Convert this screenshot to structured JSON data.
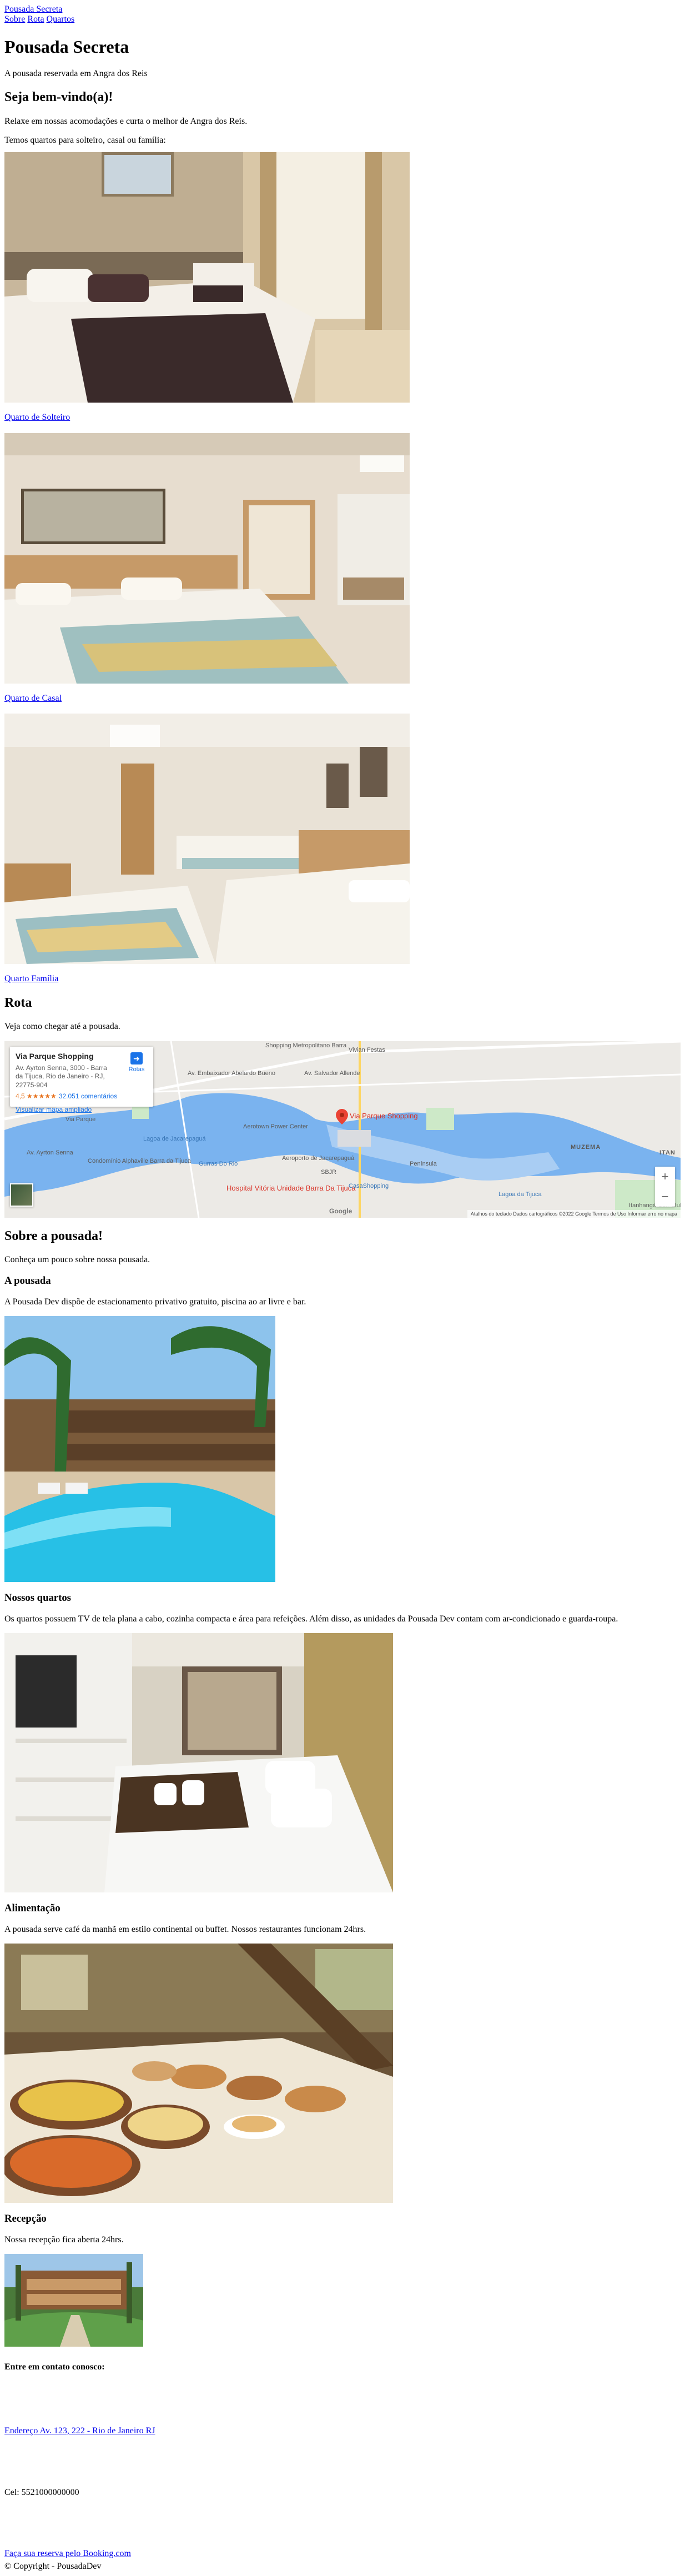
{
  "header": {
    "brand": "Pousada Secreta",
    "nav": [
      "Sobre",
      "Rota",
      "Quartos"
    ]
  },
  "hero": {
    "title": "Pousada Secreta",
    "subtitle": "A pousada reservada em Angra dos Reis"
  },
  "welcome": {
    "heading": "Seja bem-vindo(a)!",
    "p1": "Relaxe em nossas acomodações e curta o melhor de Angra dos Reis.",
    "p2": "Temos quartos para solteiro, casal ou família:"
  },
  "rooms": [
    {
      "label": "Quarto de Solteiro"
    },
    {
      "label": "Quarto de Casal"
    },
    {
      "label": "Quarto Família"
    }
  ],
  "route": {
    "heading": "Rota",
    "text": "Veja como chegar até a pousada."
  },
  "map": {
    "place_name": "Via Parque Shopping",
    "address": "Av. Ayrton Senna, 3000 - Barra da Tijuca, Rio de Janeiro - RJ, 22775-904",
    "rating": "4,5 ★★★★★",
    "reviews": "32.051 comentários",
    "enlarge_link": "Visualizar mapa ampliado",
    "route_label": "Rotas",
    "pin_label": "Via Parque Shopping",
    "labels": {
      "shopping_metropolitano": "Shopping Metropolitano Barra",
      "vivian_festas": "Vivian Festas",
      "av_embaixador": "Av. Embaixador Abelardo Bueno",
      "av_salvador": "Av. Salvador Allende",
      "via_parque": "Via Parque",
      "aerotown": "Aerotown Power Center",
      "gurras_do_rio": "Gurras Do Rio",
      "aeroporto": "Aeroporto de Jacarepaguá",
      "sbjr": "SBJR",
      "peninsula": "Península",
      "hospital": "Hospital Vitória Unidade Barra Da Tijuca",
      "casashopping": "CasaShopping",
      "condominio": "Condomínio Alphaville Barra da Tijuca",
      "lagoa_jacarepagua": "Lagoa de Jacarepaguá",
      "lagoa_tijuca": "Lagoa da Tijuca",
      "muzema": "MUZEMA",
      "itan": "ITAN",
      "av_ayrton": "Av. Ayrton Senna",
      "itanhanga": "Itanhangá Golf Club"
    },
    "google": "Google",
    "footer": "Atalhos do teclado   Dados cartográficos ©2022 Google   Termos de Uso   Informar erro no mapa"
  },
  "about": {
    "heading": "Sobre a pousada!",
    "intro": "Conheça um pouco sobre nossa pousada.",
    "sections": [
      {
        "title": "A pousada",
        "text": "A Pousada Dev dispõe de estacionamento privativo gratuito, piscina ao ar livre e bar."
      },
      {
        "title": "Nossos quartos",
        "text": "Os quartos possuem TV de tela plana a cabo, cozinha compacta e área para refeições. Além disso, as unidades da Pousada Dev contam com ar-condicionado e guarda-roupa."
      },
      {
        "title": "Alimentação",
        "text": "A pousada serve café da manhã em estilo continental ou buffet. Nossos restaurantes funcionam 24hrs."
      },
      {
        "title": "Recepção",
        "text": "Nossa recepção fica aberta 24hrs."
      }
    ]
  },
  "contact": {
    "heading": "Entre em contato conosco:",
    "address_link": "Endereço Av. 123, 222 - Rio de Janeiro RJ",
    "phone": "Cel: 5521000000000",
    "booking_link": "Faça sua reserva pelo Booking.com"
  },
  "footer": {
    "copyright": "© Copyright - PousadaDev"
  },
  "colors": {
    "link": "#0000ee",
    "visited": "#551a8b",
    "map_water": "#58a4e8",
    "map_land": "#e8eaed",
    "pin": "#ea4335"
  }
}
